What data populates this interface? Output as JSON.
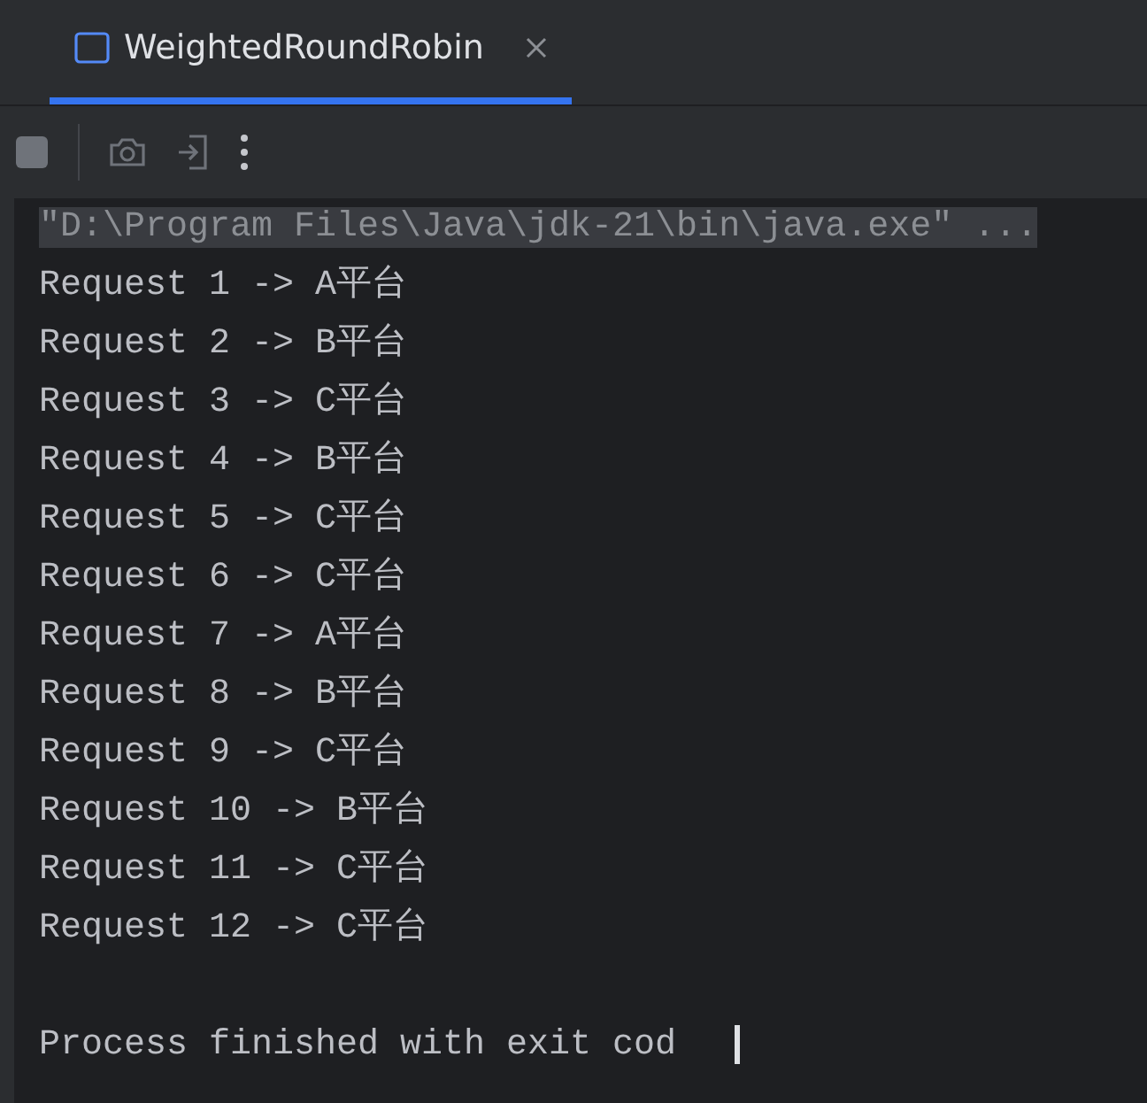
{
  "tabs": [
    {
      "label": "WeightedRoundRobin",
      "selected": true
    }
  ],
  "console": {
    "command": "\"D:\\Program Files\\Java\\jdk-21\\bin\\java.exe\" ...",
    "lines": [
      "Request 1 -> A平台",
      "Request 2 -> B平台",
      "Request 3 -> C平台",
      "Request 4 -> B平台",
      "Request 5 -> C平台",
      "Request 6 -> C平台",
      "Request 7 -> A平台",
      "Request 8 -> B平台",
      "Request 9 -> C平台",
      "Request 10 -> B平台",
      "Request 11 -> C平台",
      "Request 12 -> C平台"
    ],
    "exit_message": "Process finished with exit cod"
  }
}
